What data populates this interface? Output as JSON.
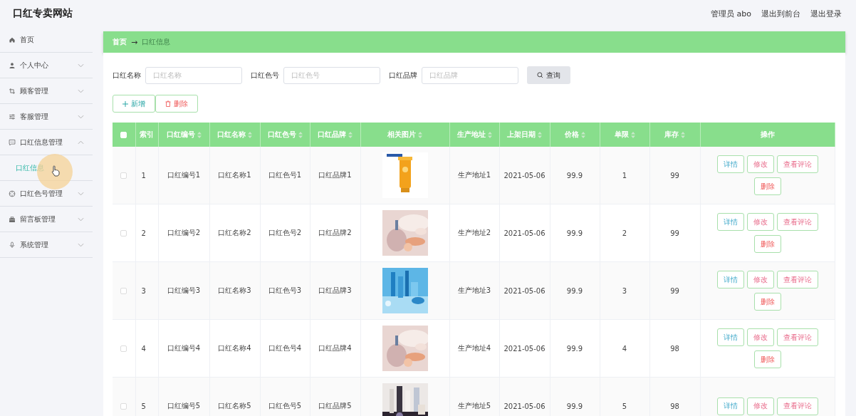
{
  "site_title": "口红专卖网站",
  "header_user": "管理员 abo",
  "header_links": [
    "退出到前台",
    "退出登录"
  ],
  "sidebar": {
    "items": [
      {
        "label": "首页",
        "kind": "link"
      },
      {
        "label": "个人中心",
        "kind": "group",
        "expanded": false
      },
      {
        "label": "顾客管理",
        "kind": "group",
        "expanded": false
      },
      {
        "label": "客服管理",
        "kind": "group",
        "expanded": false
      },
      {
        "label": "口红信息管理",
        "kind": "group",
        "expanded": true,
        "children": [
          {
            "label": "口红信息",
            "selected": true
          }
        ]
      },
      {
        "label": "口红色号管理",
        "kind": "group",
        "expanded": false
      },
      {
        "label": "留言板管理",
        "kind": "group",
        "expanded": false
      },
      {
        "label": "系统管理",
        "kind": "group",
        "expanded": false
      }
    ]
  },
  "breadcrumb": {
    "items": [
      "首页",
      "口红信息"
    ],
    "separator": "→"
  },
  "search": {
    "fields": [
      {
        "label": "口红名称",
        "placeholder": "口红名称"
      },
      {
        "label": "口红色号",
        "placeholder": "口红色号"
      },
      {
        "label": "口红品牌",
        "placeholder": "口红品牌"
      }
    ],
    "button": "查询"
  },
  "toolbar": [
    {
      "label": "新增",
      "kind": "add"
    },
    {
      "label": "删除",
      "kind": "delete"
    }
  ],
  "table": {
    "select_all_checked": false,
    "columns": [
      {
        "label": "索引",
        "sortable": false
      },
      {
        "label": "口红编号",
        "sortable": true
      },
      {
        "label": "口红名称",
        "sortable": true
      },
      {
        "label": "口红色号",
        "sortable": true
      },
      {
        "label": "口红品牌",
        "sortable": true
      },
      {
        "label": "相关图片",
        "sortable": true
      },
      {
        "label": "生产地址",
        "sortable": true
      },
      {
        "label": "上架日期",
        "sortable": true
      },
      {
        "label": "价格",
        "sortable": true
      },
      {
        "label": "单限",
        "sortable": true
      },
      {
        "label": "库存",
        "sortable": true
      },
      {
        "label": "操作",
        "sortable": false
      }
    ],
    "rows": [
      {
        "checked": false,
        "cells": [
          "1",
          "口红编号1",
          "口红名称1",
          "口红色号1",
          "口红品牌1"
        ],
        "image": {
          "kind": "picture"
        },
        "cells2": [
          "生产地址1",
          "2021-05-06",
          "99.9",
          "1",
          "99"
        ],
        "actions": [
          {
            "label": "详情",
            "kind": "detail"
          },
          {
            "label": "修改",
            "kind": "edit"
          },
          {
            "label": "查看评论",
            "kind": "comment"
          },
          {
            "label": "删除",
            "kind": "delete"
          }
        ]
      },
      {
        "checked": false,
        "cells": [
          "2",
          "口红编号2",
          "口红名称2",
          "口红色号2",
          "口红品牌2"
        ],
        "image": {
          "kind": "picture"
        },
        "cells2": [
          "生产地址2",
          "2021-05-06",
          "99.9",
          "2",
          "99"
        ],
        "actions": [
          {
            "label": "详情",
            "kind": "detail"
          },
          {
            "label": "修改",
            "kind": "edit"
          },
          {
            "label": "查看评论",
            "kind": "comment"
          },
          {
            "label": "删除",
            "kind": "delete"
          }
        ]
      },
      {
        "checked": false,
        "cells": [
          "3",
          "口红编号3",
          "口红名称3",
          "口红色号3",
          "口红品牌3"
        ],
        "image": {
          "kind": "picture"
        },
        "cells2": [
          "生产地址3",
          "2021-05-06",
          "99.9",
          "3",
          "99"
        ],
        "actions": [
          {
            "label": "详情",
            "kind": "detail"
          },
          {
            "label": "修改",
            "kind": "edit"
          },
          {
            "label": "查看评论",
            "kind": "comment"
          },
          {
            "label": "删除",
            "kind": "delete"
          }
        ]
      },
      {
        "checked": false,
        "cells": [
          "4",
          "口红编号4",
          "口红名称4",
          "口红色号4",
          "口红品牌4"
        ],
        "image": {
          "kind": "picture"
        },
        "cells2": [
          "生产地址4",
          "2021-05-06",
          "99.9",
          "4",
          "98"
        ],
        "actions": [
          {
            "label": "详情",
            "kind": "detail"
          },
          {
            "label": "修改",
            "kind": "edit"
          },
          {
            "label": "查看评论",
            "kind": "comment"
          },
          {
            "label": "删除",
            "kind": "delete"
          }
        ]
      },
      {
        "checked": false,
        "cells": [
          "5",
          "口红编号5",
          "口红名称5",
          "口红色号5",
          "口红品牌5"
        ],
        "image": {
          "kind": "picture"
        },
        "cells2": [
          "生产地址5",
          "2021-05-06",
          "99.9",
          "5",
          "98"
        ],
        "actions": [
          {
            "label": "详情",
            "kind": "detail"
          },
          {
            "label": "修改",
            "kind": "edit"
          },
          {
            "label": "查看评论",
            "kind": "comment"
          }
        ]
      }
    ]
  }
}
